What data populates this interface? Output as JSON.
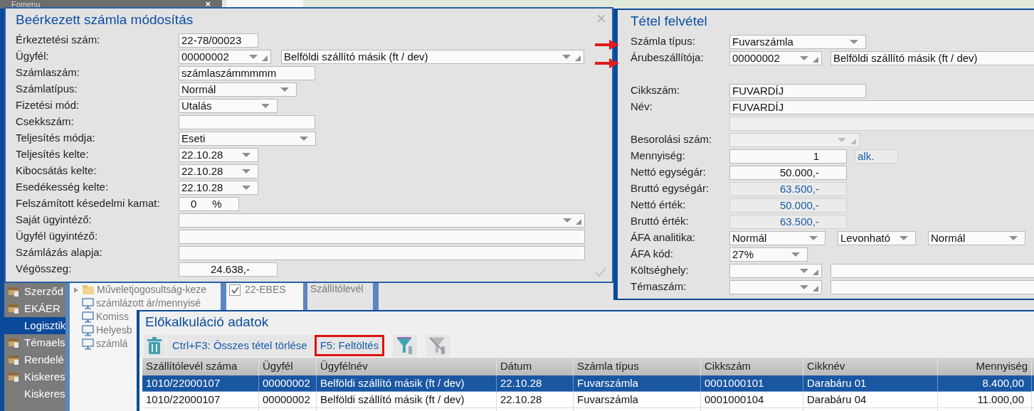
{
  "main_menu": {
    "title": "Fomenu",
    "close": "×",
    "items": [
      {
        "label": "Szerződ",
        "kind": "group",
        "selected": false
      },
      {
        "label": "EKÁER",
        "kind": "group",
        "selected": false
      },
      {
        "label": "Logisztik",
        "kind": "sub",
        "selected": true
      },
      {
        "label": "Témaels",
        "kind": "group",
        "selected": false
      },
      {
        "label": "Rendelé",
        "kind": "group",
        "selected": false
      },
      {
        "label": "Kiskeres",
        "kind": "group",
        "selected": false
      },
      {
        "label": "Kiskeres",
        "kind": "sub",
        "selected": false
      }
    ]
  },
  "tree": [
    {
      "label": "Műveletjogosultság-keze",
      "kind": "folder"
    },
    {
      "label": "számlázott ár/mennyisé",
      "kind": "screen"
    },
    {
      "label": "Komiss",
      "kind": "screen"
    },
    {
      "label": "Helyesb",
      "kind": "screen"
    },
    {
      "label": "számlá",
      "kind": "screen"
    }
  ],
  "background_list": [
    {
      "label": "22-EBES",
      "checked": true
    }
  ],
  "background_tab": "Szállítólevél",
  "invoice_dialog": {
    "title": "Beérkezett számla módosítás",
    "close": "×",
    "rows": [
      {
        "label": "Érkeztetési szám:",
        "inputs": [
          {
            "kind": "text",
            "value": "22-78/00023"
          }
        ]
      },
      {
        "label": "Ügyfél:",
        "inputs": [
          {
            "kind": "lookup",
            "value": "00000002"
          },
          {
            "kind": "lookup",
            "value": "Belföldi szállító másik (ft / dev)"
          }
        ]
      },
      {
        "label": "Számlaszám:",
        "inputs": [
          {
            "kind": "text",
            "value": "számlaszámmmmm"
          }
        ]
      },
      {
        "label": "Számlatípus:",
        "inputs": [
          {
            "kind": "dropdown",
            "value": "Normál"
          }
        ]
      },
      {
        "label": "Fizetési mód:",
        "inputs": [
          {
            "kind": "dropdown",
            "value": "Utalás"
          }
        ]
      },
      {
        "label": "Csekkszám:",
        "inputs": [
          {
            "kind": "text"
          }
        ]
      },
      {
        "label": "Teljesítés módja:",
        "inputs": [
          {
            "kind": "dropdown",
            "value": "Eseti"
          }
        ]
      },
      {
        "label": "Teljesítés kelte:",
        "inputs": [
          {
            "kind": "dropdown",
            "value": "22.10.28"
          }
        ]
      },
      {
        "label": "Kibocsátás kelte:",
        "inputs": [
          {
            "kind": "dropdown",
            "value": "22.10.28"
          }
        ]
      },
      {
        "label": "Esedékesség kelte:",
        "inputs": [
          {
            "kind": "dropdown",
            "value": "22.10.28"
          }
        ]
      },
      {
        "label": "Felszámított késedelmi kamat:",
        "inputs": [
          {
            "kind": "percent",
            "value": "0",
            "suffix": "%"
          }
        ]
      },
      {
        "label": "Saját ügyintéző:",
        "inputs": [
          {
            "kind": "lookup"
          }
        ]
      },
      {
        "label": "Ügyfél ügyintéző:",
        "inputs": [
          {
            "kind": "text"
          }
        ]
      },
      {
        "label": "Számlázás alapja:",
        "inputs": [
          {
            "kind": "text"
          }
        ]
      },
      {
        "label": "Végösszeg:",
        "inputs": [
          {
            "kind": "number",
            "value": "24.638,-"
          }
        ]
      }
    ]
  },
  "item_dialog": {
    "title": "Tétel felvétel",
    "rows": [
      {
        "label": "Számla típus:",
        "inputs": [
          {
            "kind": "dropdown",
            "value": "Fuvarszámla"
          }
        ]
      },
      {
        "label": "Árubeszállítója:",
        "inputs": [
          {
            "kind": "lookup",
            "value": "00000002"
          },
          {
            "kind": "text",
            "value": "Belföldi szállító másik (ft / dev)"
          }
        ]
      },
      {
        "label": "Cikkszám:",
        "inputs": [
          {
            "kind": "text",
            "value": "FUVARDÍJ"
          }
        ]
      },
      {
        "label": "Név:",
        "inputs": [
          {
            "kind": "text",
            "value": "FUVARDÍJ"
          }
        ]
      },
      {
        "inputs": [
          {
            "kind": "text",
            "disabled": true
          }
        ]
      },
      {
        "label": "Besorolási szám:",
        "inputs": [
          {
            "kind": "lookup",
            "disabled": true
          }
        ]
      },
      {
        "label": "Mennyiség:",
        "inputs": [
          {
            "kind": "number",
            "value": "1"
          },
          {
            "kind": "unit",
            "value": "alk."
          }
        ]
      },
      {
        "label": "Nettó egységár:",
        "inputs": [
          {
            "kind": "number",
            "value": "50.000,-"
          }
        ]
      },
      {
        "label": "Bruttó egységár:",
        "inputs": [
          {
            "kind": "number",
            "value": "63.500,-",
            "readonly": true
          }
        ]
      },
      {
        "label": "Nettó érték:",
        "inputs": [
          {
            "kind": "number",
            "value": "50.000,-",
            "readonly": true
          }
        ]
      },
      {
        "label": "Bruttó érték:",
        "inputs": [
          {
            "kind": "number",
            "value": "63.500,-",
            "readonly": true
          }
        ]
      },
      {
        "label": "ÁFA analitika:",
        "inputs": [
          {
            "kind": "dropdown",
            "value": "Normál"
          },
          {
            "kind": "dropdown",
            "value": "Levonható"
          },
          {
            "kind": "dropdown",
            "value": "Normál"
          }
        ]
      },
      {
        "label": "ÁFA kód:",
        "inputs": [
          {
            "kind": "dropdown",
            "value": "27%"
          }
        ]
      },
      {
        "label": "Költséghely:",
        "inputs": [
          {
            "kind": "lookup"
          },
          {
            "kind": "text"
          }
        ]
      },
      {
        "label": "Témaszám:",
        "inputs": [
          {
            "kind": "lookup"
          },
          {
            "kind": "text"
          }
        ]
      }
    ]
  },
  "precalc_panel": {
    "title": "Előkalkuláció adatok",
    "toolbar": [
      {
        "kind": "delete",
        "highlighted": false,
        "disabled": false
      },
      {
        "kind": "label",
        "label": "Ctrl+F3: Összes tétel törlése",
        "highlighted": false,
        "disabled": false
      },
      {
        "kind": "label",
        "label": "F5: Feltöltés",
        "highlighted": true,
        "disabled": false
      },
      {
        "kind": "filter",
        "highlighted": false,
        "disabled": false
      },
      {
        "kind": "clear_filter",
        "highlighted": false,
        "disabled": true
      }
    ],
    "table": {
      "columns": [
        "Szállítólevél száma",
        "Ügyfél",
        "Ügyfélnév",
        "Dátum",
        "Számla típus",
        "Cikkszám",
        "Cikknév",
        "Mennyiség"
      ],
      "rows": [
        {
          "selected": true,
          "cells": [
            "1010/22000107",
            "00000002",
            "Belföldi szállító másik (ft / dev)",
            "22.10.28",
            "Fuvarszámla",
            "0001000101",
            "Darabáru 01",
            "8.400,00"
          ]
        },
        {
          "selected": false,
          "cells": [
            "1010/22000107",
            "00000002",
            "Belföldi szállító másik (ft / dev)",
            "22.10.28",
            "Fuvarszámla",
            "0001000104",
            "Darabáru 04",
            "11.000,00"
          ]
        }
      ]
    }
  }
}
